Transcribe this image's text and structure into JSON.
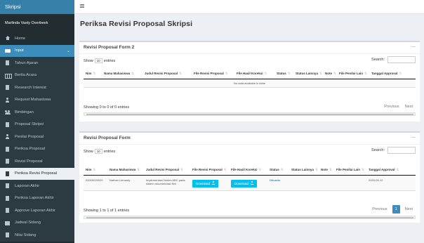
{
  "app": {
    "brand": "Skripsi",
    "user": "Marlinda Vasty Overbeek"
  },
  "menu": [
    {
      "label": "Home",
      "icon": "home-icon"
    },
    {
      "label": "Input",
      "icon": "input-icon"
    },
    {
      "label": "Tahun Ajaran",
      "icon": "document-icon"
    },
    {
      "label": "Berita Acara",
      "icon": "table-icon"
    },
    {
      "label": "Research Interest",
      "icon": "document-icon"
    },
    {
      "label": "Request Mahasiswa",
      "icon": "user-icon"
    },
    {
      "label": "Bimbingan",
      "icon": "users-icon"
    },
    {
      "label": "Proposal Skripsi",
      "icon": "document-icon"
    },
    {
      "label": "Penilai Proposal",
      "icon": "user-icon"
    },
    {
      "label": "Periksa Proposal",
      "icon": "document-icon"
    },
    {
      "label": "Revisi Proposal",
      "icon": "document-icon"
    },
    {
      "label": "Periksa Revisi Proposal",
      "icon": "document-icon"
    },
    {
      "label": "Laporan Akhir",
      "icon": "document-icon"
    },
    {
      "label": "Periksa Laporan Akhir",
      "icon": "document-icon"
    },
    {
      "label": "Approve Laporan Akhir",
      "icon": "document-icon"
    },
    {
      "label": "Jadwal Sidang",
      "icon": "calendar-icon"
    },
    {
      "label": "Nilai Sidang",
      "icon": "document-icon"
    }
  ],
  "page": {
    "title": "Periksa Revisi Proposal Skripsi"
  },
  "box1": {
    "title": "Revisi Proposal Form 2",
    "tools": "—",
    "show_prefix": "Show",
    "show_value": "10",
    "show_suffix": "entries",
    "search_label": "Search:",
    "columns": [
      "Nim",
      "Nama Mahasiswa",
      "Judul Revisi Proposal",
      "File Revisi Proposal",
      "File Hasil Koreksi",
      "Status",
      "Status Lainnya",
      "Note",
      "File Penilai Lain",
      "Tanggal Approval"
    ],
    "empty_text": "No data available in table",
    "info": "Showing 0 to 0 of 0 entries",
    "prev": "Previous",
    "next": "Next"
  },
  "box2": {
    "title": "Revisi Proposal Form",
    "tools": "—",
    "show_prefix": "Show",
    "show_value": "10",
    "show_suffix": "entries",
    "search_label": "Search:",
    "columns": [
      "Nim",
      "Nama Mahasiswa",
      "Judul Revisi Proposal",
      "File Revisi Proposal",
      "File Hasil Koreksi",
      "Status",
      "Status Lainnya",
      "Note",
      "File Penilai Lain",
      "Tanggal Approval"
    ],
    "rows": [
      {
        "nim": "00000020020",
        "nama": "Nathan Lienardy",
        "judul": "Implementasi Nodes ABC pada sistem rekomendasi film",
        "file_revisi": "Download",
        "file_koreksi": "Download",
        "status": "Ditunda",
        "status_lain": "",
        "note": "",
        "file_penilai": "",
        "tanggal": "2020-05-12"
      }
    ],
    "info": "Showing 1 to 1 of 1 entries",
    "prev": "Previous",
    "page": "1",
    "next": "Next"
  }
}
